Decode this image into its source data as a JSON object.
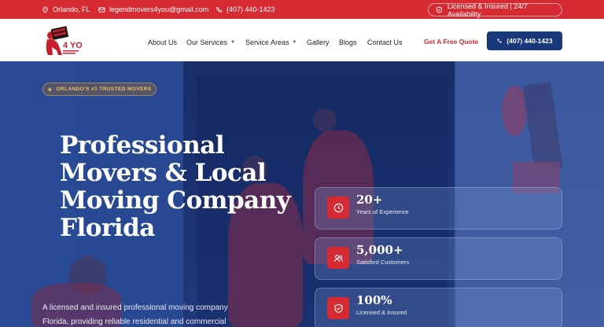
{
  "topbar": {
    "location": "Orlando, FL",
    "email": "legendmovers4you@gmail.com",
    "phone": "(407) 440-1423",
    "license": "Licensed & Insured | 24/7 Availability"
  },
  "logo": {
    "alt_text": "Legend Movers 4 You"
  },
  "nav": {
    "items": [
      {
        "label": "About Us",
        "dropdown": false
      },
      {
        "label": "Our Services",
        "dropdown": true
      },
      {
        "label": "Service Areas",
        "dropdown": true
      },
      {
        "label": "Gallery",
        "dropdown": false
      },
      {
        "label": "Blogs",
        "dropdown": false
      },
      {
        "label": "Contact Us",
        "dropdown": false
      }
    ],
    "quote_label": "Get A Free Quote",
    "call_label": "(407) 440-1423"
  },
  "hero": {
    "badge": "ORLANDO'S #1 TRUSTED MOVERS",
    "title": "Professional Movers & Local Moving Company Florida",
    "description": "A licensed and insured professional moving company Florida, providing reliable residential and commercial"
  },
  "stats": [
    {
      "value": "20+",
      "label": "Years of Experience",
      "icon": "clock-icon"
    },
    {
      "value": "5,000+",
      "label": "Satisfied Customers",
      "icon": "users-icon"
    },
    {
      "value": "100%",
      "label": "Licensed & Insured",
      "icon": "shield-icon"
    }
  ],
  "colors": {
    "brand_red": "#d62a32",
    "brand_blue": "#17397a",
    "badge_gold": "#f0c060"
  }
}
